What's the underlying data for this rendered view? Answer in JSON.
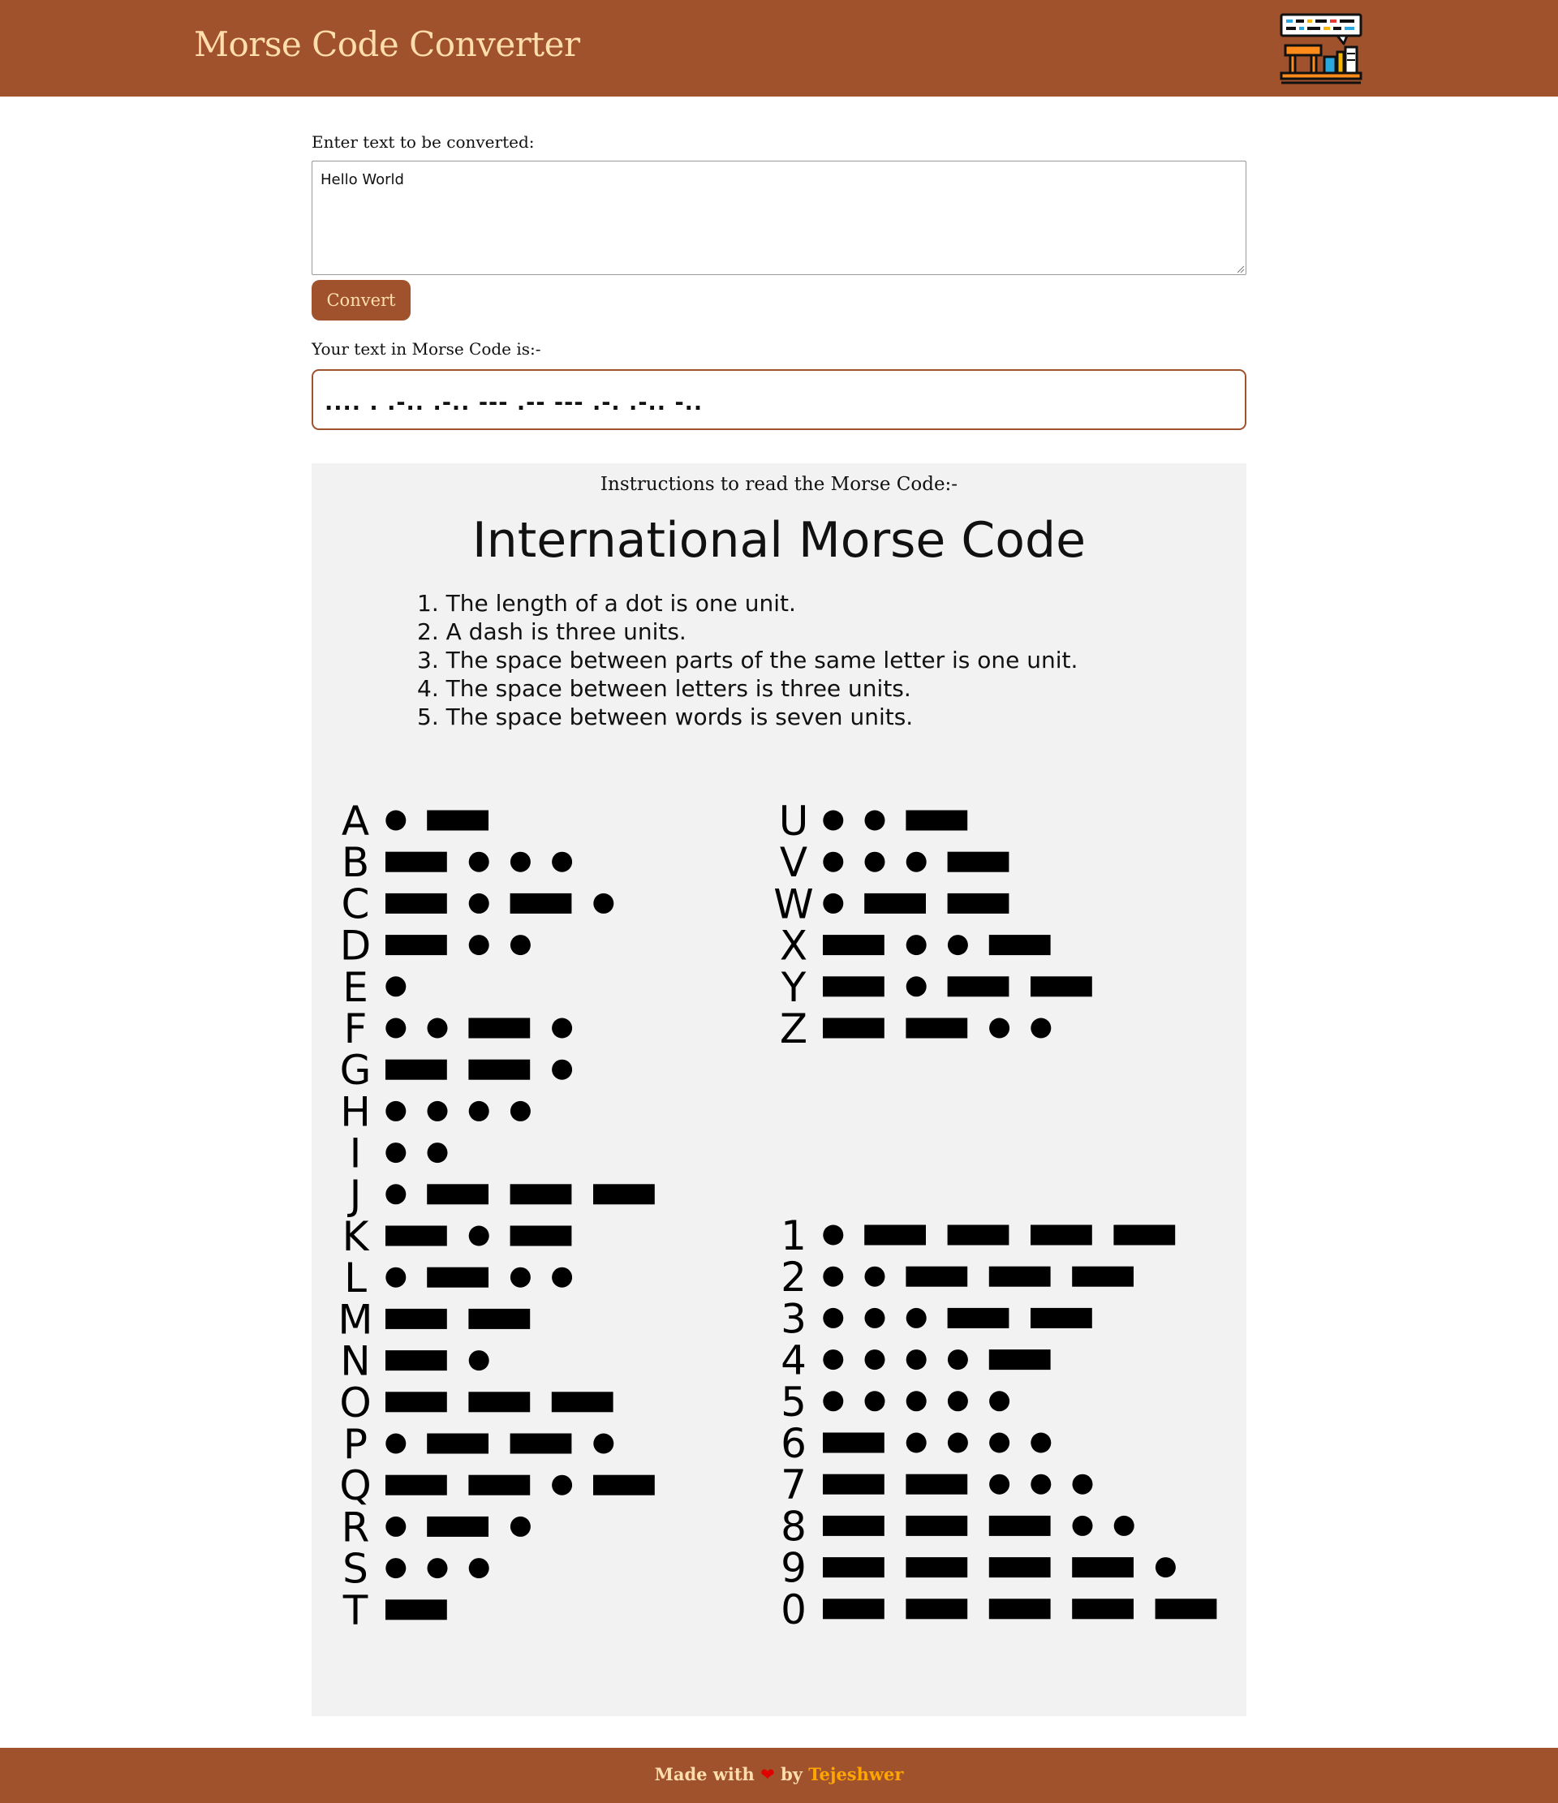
{
  "header": {
    "title": "Morse Code Converter",
    "logo_icon": "desk-with-chat-bubble-icon",
    "background": "#a0522d",
    "title_color": "#ffdead"
  },
  "converter": {
    "input_label": "Enter text to be converted:",
    "input_value": "Hello World",
    "convert_label": "Convert",
    "output_label": "Your text in Morse Code is:-",
    "output_value": ".... . .-.. .-.. --- .-- --- .-. .-.. -.."
  },
  "instructions": {
    "heading": "Instructions to read the Morse Code:-",
    "chart_title": "International Morse Code",
    "rules": [
      "1. The length of a dot is one unit.",
      "2. A dash is three units.",
      "3. The space between parts of the same letter is one unit.",
      "4. The space between letters is three units.",
      "5. The space between words is seven units."
    ],
    "letters": [
      {
        "char": "A",
        "code": ".-"
      },
      {
        "char": "B",
        "code": "-..."
      },
      {
        "char": "C",
        "code": "-.-."
      },
      {
        "char": "D",
        "code": "-.."
      },
      {
        "char": "E",
        "code": "."
      },
      {
        "char": "F",
        "code": "..-."
      },
      {
        "char": "G",
        "code": "--."
      },
      {
        "char": "H",
        "code": "...."
      },
      {
        "char": "I",
        "code": ".."
      },
      {
        "char": "J",
        "code": ".---"
      },
      {
        "char": "K",
        "code": "-.-"
      },
      {
        "char": "L",
        "code": ".-.."
      },
      {
        "char": "M",
        "code": "--"
      },
      {
        "char": "N",
        "code": "-."
      },
      {
        "char": "O",
        "code": "---"
      },
      {
        "char": "P",
        "code": ".--."
      },
      {
        "char": "Q",
        "code": "--.-"
      },
      {
        "char": "R",
        "code": ".-."
      },
      {
        "char": "S",
        "code": "..."
      },
      {
        "char": "T",
        "code": "-"
      },
      {
        "char": "U",
        "code": "..-"
      },
      {
        "char": "V",
        "code": "...-"
      },
      {
        "char": "W",
        "code": ".--"
      },
      {
        "char": "X",
        "code": "-..-"
      },
      {
        "char": "Y",
        "code": "-.--"
      },
      {
        "char": "Z",
        "code": "--.."
      }
    ],
    "digits": [
      {
        "char": "1",
        "code": ".----"
      },
      {
        "char": "2",
        "code": "..---"
      },
      {
        "char": "3",
        "code": "...--"
      },
      {
        "char": "4",
        "code": "....-"
      },
      {
        "char": "5",
        "code": "....."
      },
      {
        "char": "6",
        "code": "-...."
      },
      {
        "char": "7",
        "code": "--..."
      },
      {
        "char": "8",
        "code": "---.."
      },
      {
        "char": "9",
        "code": "----."
      },
      {
        "char": "0",
        "code": "-----"
      }
    ]
  },
  "footer": {
    "prefix": "Made with",
    "heart_icon": "heart-icon",
    "by": "by",
    "author": "Tejeshwer",
    "author_color": "#ffa500"
  }
}
